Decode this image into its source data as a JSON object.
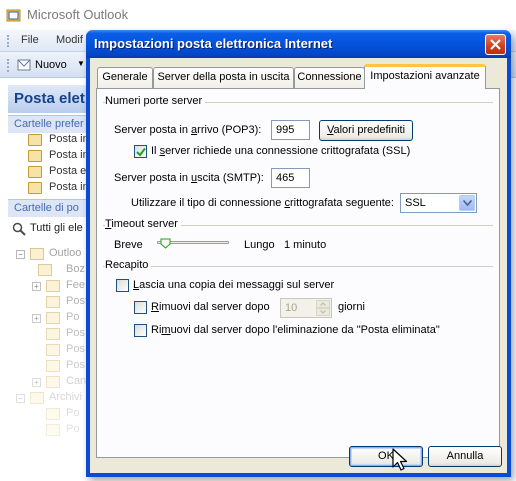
{
  "outlook": {
    "title": "Microsoft Outlook",
    "menu": [
      "File",
      "Modif"
    ],
    "toolbar": {
      "new_label": "Nuovo"
    },
    "nav_header": "Posta elet",
    "favorites_header": "Cartelle prefer",
    "favorites": [
      "Posta in",
      "Posta in",
      "Posta e",
      "Posta in"
    ],
    "all_folders_header": "Cartelle di po",
    "all_items": "Tutti gli ele",
    "tree": [
      "Outloo",
      "Boz",
      "Fee",
      "Post",
      "Po",
      "Pos",
      "Pos",
      "Pos",
      "Can",
      "Archivi",
      "Po",
      "Po"
    ]
  },
  "dialog": {
    "title": "Impostazioni posta elettronica Internet",
    "tabs": [
      "Generale",
      "Server della posta in uscita",
      "Connessione",
      "Impostazioni avanzate"
    ],
    "active_tab": 3,
    "ports": {
      "group_title": "Numeri porte server",
      "incoming_label_pre": "Server posta in ",
      "incoming_label_accel": "a",
      "incoming_label_post": "rrivo (POP3):",
      "incoming_value": "995",
      "defaults_button_accel": "V",
      "defaults_button_rest": "alori predefiniti",
      "ssl_checked": true,
      "ssl_label_pre": "Il ",
      "ssl_label_accel": "s",
      "ssl_label_post": "erver richiede una connessione crittografata (SSL)",
      "outgoing_label_pre": "Server posta in ",
      "outgoing_label_accel": "u",
      "outgoing_label_post": "scita (SMTP):",
      "outgoing_value": "465",
      "encryption_label_pre": "Utilizzare il tipo di connessione ",
      "encryption_label_accel": "c",
      "encryption_label_post": "rittografata seguente:",
      "encryption_value": "SSL"
    },
    "timeout": {
      "group_title_accel": "T",
      "group_title_rest": "imeout server",
      "short_label": "Breve",
      "long_label": "Lungo",
      "value": "1 minuto",
      "level": 0.05
    },
    "delivery": {
      "group_title": "Recapito",
      "leave_copy_checked": false,
      "leave_copy_accel": "L",
      "leave_copy_rest": "ascia una copia dei messaggi sul server",
      "remove_after_checked": false,
      "remove_after_accel": "R",
      "remove_after_rest": "imuovi dal server dopo",
      "remove_after_days": "10",
      "days_label": "giorni",
      "remove_deleted_checked": false,
      "remove_deleted_pre": "Ri",
      "remove_deleted_accel": "m",
      "remove_deleted_post": "uovi dal server dopo l'eliminazione da \"Posta eliminata\""
    },
    "buttons": {
      "ok": "OK",
      "cancel": "Annulla"
    }
  },
  "colors": {
    "title_bar": "#0553dd",
    "dialog_face": "#ece9d8",
    "active_tab_accent": "#ffc83c",
    "close_button": "#cf3f1a"
  }
}
